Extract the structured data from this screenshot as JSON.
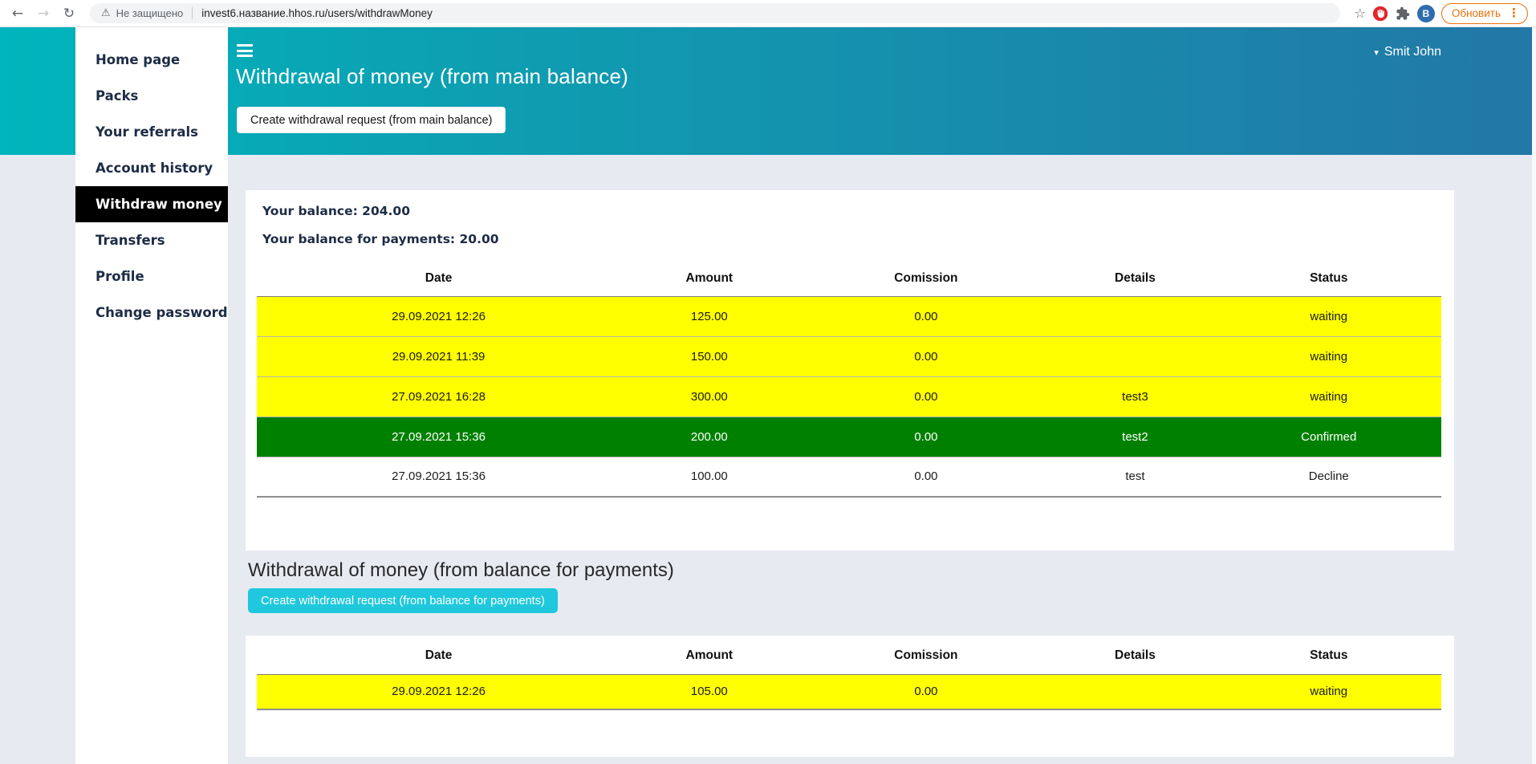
{
  "colors": {
    "header_teal": "#00b5bd",
    "header_blue": "#2278a6",
    "row_waiting_yellow": "#ffff00",
    "row_confirmed_green": "#008000",
    "cyan_button": "#1fc8dc",
    "active_item_bg": "#000000",
    "update_orange": "#e8710a",
    "page_background": "#e8eaf2"
  },
  "browser": {
    "security_label": "Не защищено",
    "url": "invest6.название.hhos.ru/users/withdrawMoney",
    "update_button_label": "Обновить",
    "profile_letter": "B"
  },
  "header": {
    "title": "Withdrawal of money (from main balance)",
    "user_name": "Smit John"
  },
  "sidebar": {
    "items": [
      {
        "label": "Home page",
        "active": false
      },
      {
        "label": "Packs",
        "active": false
      },
      {
        "label": "Your referrals",
        "active": false
      },
      {
        "label": "Account history",
        "active": false
      },
      {
        "label": "Withdraw money",
        "active": true
      },
      {
        "label": "Transfers",
        "active": false
      },
      {
        "label": "Profile",
        "active": false
      },
      {
        "label": "Change password",
        "active": false
      }
    ]
  },
  "main": {
    "create_main_button": "Create withdrawal request (from main balance)",
    "balance_text": "Your balance: 204.00",
    "balance_payments_text": "Your balance for payments: 20.00",
    "section2_title": "Withdrawal of money (from balance for payments)",
    "create_payments_button": "Create withdrawal request (from balance for payments)"
  },
  "tables": [
    {
      "columns": [
        "Date",
        "Amount",
        "Comission",
        "Details",
        "Status"
      ],
      "rows": [
        {
          "style": "waiting",
          "cells": [
            "29.09.2021 12:26",
            "125.00",
            "0.00",
            "",
            "waiting"
          ]
        },
        {
          "style": "waiting",
          "cells": [
            "29.09.2021 11:39",
            "150.00",
            "0.00",
            "",
            "waiting"
          ]
        },
        {
          "style": "waiting",
          "cells": [
            "27.09.2021 16:28",
            "300.00",
            "0.00",
            "test3",
            "waiting"
          ]
        },
        {
          "style": "confirmed",
          "cells": [
            "27.09.2021 15:36",
            "200.00",
            "0.00",
            "test2",
            "Confirmed"
          ]
        },
        {
          "style": "declined",
          "cells": [
            "27.09.2021 15:36",
            "100.00",
            "0.00",
            "test",
            "Decline"
          ]
        }
      ]
    },
    {
      "columns": [
        "Date",
        "Amount",
        "Comission",
        "Details",
        "Status"
      ],
      "rows": [
        {
          "style": "waiting",
          "cells": [
            "29.09.2021 12:26",
            "105.00",
            "0.00",
            "",
            "waiting"
          ]
        }
      ]
    }
  ]
}
